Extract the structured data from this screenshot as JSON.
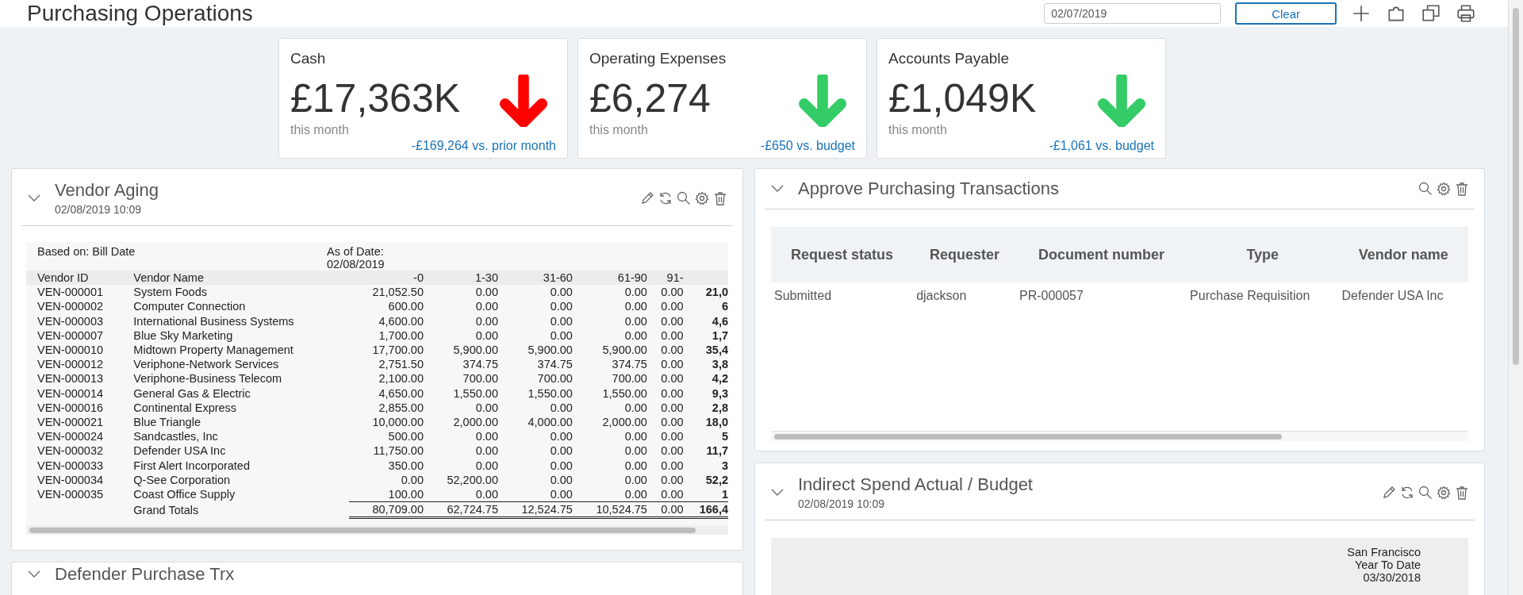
{
  "header": {
    "title": "Purchasing Operations",
    "date_field": {
      "value": "02/07/2019"
    },
    "clear_button": "Clear"
  },
  "kpis": [
    {
      "title": "Cash",
      "value": "£17,363K",
      "period": "this month",
      "color": "#ff0000",
      "comparison": "-£169,264 vs. prior month"
    },
    {
      "title": "Operating Expenses",
      "value": "£6,274",
      "period": "this month",
      "color": "#33cc66",
      "comparison": "-£650 vs. budget"
    },
    {
      "title": "Accounts Payable",
      "value": "£1,049K",
      "period": "this month",
      "color": "#33cc66",
      "comparison": "-£1,061 vs. budget"
    }
  ],
  "vendor_aging": {
    "title": "Vendor Aging",
    "timestamp": "02/08/2019 10:09",
    "based_on": "Based on: Bill Date",
    "as_of_label": "As of Date:",
    "as_of_date": "02/08/2019",
    "columns": [
      "Vendor ID",
      "Vendor Name",
      "-0",
      "1-30",
      "31-60",
      "61-90",
      "91-"
    ],
    "rows": [
      [
        "VEN-000001",
        "System Foods",
        "21,052.50",
        "0.00",
        "0.00",
        "0.00",
        "0.00",
        "21,0"
      ],
      [
        "VEN-000002",
        "Computer Connection",
        "600.00",
        "0.00",
        "0.00",
        "0.00",
        "0.00",
        "6"
      ],
      [
        "VEN-000003",
        "International Business Systems",
        "4,600.00",
        "0.00",
        "0.00",
        "0.00",
        "0.00",
        "4,6"
      ],
      [
        "VEN-000007",
        "Blue Sky Marketing",
        "1,700.00",
        "0.00",
        "0.00",
        "0.00",
        "0.00",
        "1,7"
      ],
      [
        "VEN-000010",
        "Midtown Property Management",
        "17,700.00",
        "5,900.00",
        "5,900.00",
        "5,900.00",
        "0.00",
        "35,4"
      ],
      [
        "VEN-000012",
        "Veriphone-Network Services",
        "2,751.50",
        "374.75",
        "374.75",
        "374.75",
        "0.00",
        "3,8"
      ],
      [
        "VEN-000013",
        "Veriphone-Business Telecom",
        "2,100.00",
        "700.00",
        "700.00",
        "700.00",
        "0.00",
        "4,2"
      ],
      [
        "VEN-000014",
        "General Gas & Electric",
        "4,650.00",
        "1,550.00",
        "1,550.00",
        "1,550.00",
        "0.00",
        "9,3"
      ],
      [
        "VEN-000016",
        "Continental Express",
        "2,855.00",
        "0.00",
        "0.00",
        "0.00",
        "0.00",
        "2,8"
      ],
      [
        "VEN-000021",
        "Blue Triangle",
        "10,000.00",
        "2,000.00",
        "4,000.00",
        "2,000.00",
        "0.00",
        "18,0"
      ],
      [
        "VEN-000024",
        "Sandcastles, Inc",
        "500.00",
        "0.00",
        "0.00",
        "0.00",
        "0.00",
        "5"
      ],
      [
        "VEN-000032",
        "Defender USA Inc",
        "11,750.00",
        "0.00",
        "0.00",
        "0.00",
        "0.00",
        "11,7"
      ],
      [
        "VEN-000033",
        "First Alert Incorporated",
        "350.00",
        "0.00",
        "0.00",
        "0.00",
        "0.00",
        "3"
      ],
      [
        "VEN-000034",
        "Q-See Corporation",
        "0.00",
        "52,200.00",
        "0.00",
        "0.00",
        "0.00",
        "52,2"
      ],
      [
        "VEN-000035",
        "Coast Office Supply",
        "100.00",
        "0.00",
        "0.00",
        "0.00",
        "0.00",
        "1"
      ]
    ],
    "totals": {
      "label": "Grand Totals",
      "values": [
        "80,709.00",
        "62,724.75",
        "12,524.75",
        "10,524.75",
        "0.00",
        "166,4"
      ]
    }
  },
  "approve_transactions": {
    "title": "Approve Purchasing Transactions",
    "columns": [
      "Request status",
      "Requester",
      "Document number",
      "Type",
      "Vendor name"
    ],
    "rows": [
      [
        "Submitted",
        "djackson",
        "PR-000057",
        "Purchase Requisition",
        "Defender USA Inc"
      ]
    ]
  },
  "indirect_spend": {
    "title": "Indirect Spend Actual / Budget",
    "timestamp": "02/08/2019 10:09",
    "report_header": [
      "San Francisco",
      "Year To Date",
      "03/30/2018"
    ]
  },
  "defender_purchase": {
    "title": "Defender Purchase Trx"
  }
}
